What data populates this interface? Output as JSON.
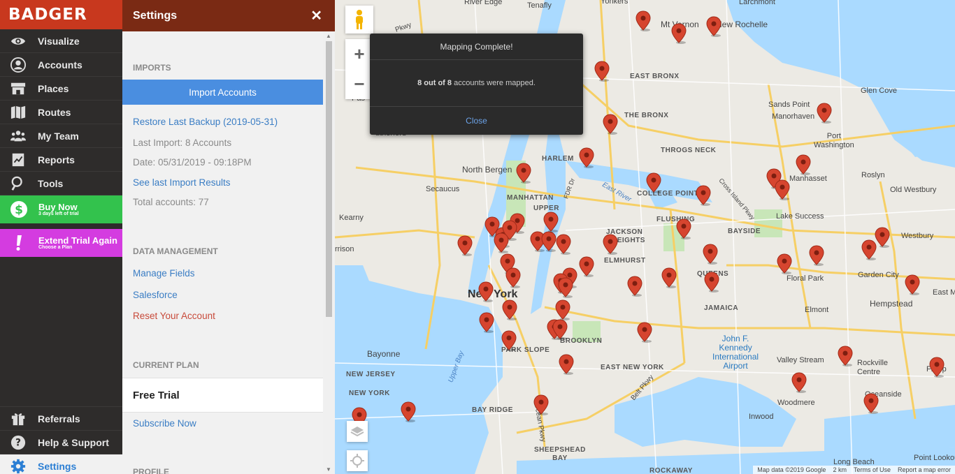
{
  "app": {
    "logo": "BADGER"
  },
  "nav": {
    "items": [
      {
        "label": "Visualize",
        "icon": "eye-icon"
      },
      {
        "label": "Accounts",
        "icon": "user-circle-icon"
      },
      {
        "label": "Places",
        "icon": "store-icon"
      },
      {
        "label": "Routes",
        "icon": "map-icon"
      },
      {
        "label": "My Team",
        "icon": "team-icon"
      },
      {
        "label": "Reports",
        "icon": "report-icon"
      },
      {
        "label": "Tools",
        "icon": "tools-icon"
      }
    ],
    "buy_now": {
      "title": "Buy Now",
      "subtitle": "3 days left of trial"
    },
    "extend": {
      "title": "Extend Trial Again",
      "subtitle": "Choose a Plan"
    },
    "bottom": [
      {
        "label": "Referrals",
        "icon": "gift-icon"
      },
      {
        "label": "Help & Support",
        "icon": "help-icon"
      },
      {
        "label": "Settings",
        "icon": "gear-icon"
      }
    ]
  },
  "panel": {
    "title": "Settings",
    "close": "✕",
    "imports": {
      "heading": "IMPORTS",
      "import_button": "Import Accounts",
      "restore": "Restore Last Backup (2019-05-31)",
      "last_import": "Last Import: 8 Accounts",
      "date": "Date: 05/31/2019 - 09:18PM",
      "see_results": "See last Import Results",
      "total": "Total accounts: 77"
    },
    "data_management": {
      "heading": "DATA MANAGEMENT",
      "manage_fields": "Manage Fields",
      "salesforce": "Salesforce",
      "reset": "Reset Your Account"
    },
    "current_plan": {
      "heading": "CURRENT PLAN",
      "plan": "Free Trial",
      "subscribe": "Subscribe Now"
    },
    "profile": {
      "heading": "PROFILE"
    }
  },
  "modal": {
    "title": "Mapping Complete!",
    "mapped": "8",
    "total": "8",
    "out_of": "out of",
    "suffix": "accounts were mapped.",
    "close": "Close"
  },
  "map": {
    "labels": {
      "river_edge": "River Edge",
      "tenafly": "Tenafly",
      "yonkers": "Yonkers",
      "mt_vernon": "Mt Vernon",
      "new_rochelle": "New Rochelle",
      "larchmont": "Larchmont",
      "east_bronx": "EAST BRONX",
      "the_bronx": "THE BRONX",
      "glen_cove": "Glen Cove",
      "sands_point": "Sands Point",
      "manorhaven": "Manorhaven",
      "port_washington": "Port\nWashington",
      "throgs_neck": "THROGS NECK",
      "harlem": "HARLEM",
      "north_bergen": "North Bergen",
      "secaucus": "Secaucus",
      "manhasset": "Manhasset",
      "roslyn": "Roslyn",
      "old_westbury": "Old Westbury",
      "college_point": "COLLEGE POINT",
      "manhattan": "MANHATTAN",
      "upper": "UPPER",
      "east_river": "East River",
      "flushing": "FLUSHING",
      "lake_success": "Lake Success",
      "kearny": "Kearny",
      "bayside": "BAYSIDE",
      "jackson": "JACKSON",
      "heights": "HEIGHTS",
      "westbury": "Westbury",
      "elmhurst": "ELMHURST",
      "queens": "QUEENS",
      "floral_park": "Floral Park",
      "garden_city": "Garden City",
      "new_york": "New York",
      "jamaica": "JAMAICA",
      "hempstead": "Hempstead",
      "east_m": "East M",
      "elmont": "Elmont",
      "brooklyn": "BROOKLYN",
      "park_slope": "PARK SLOPE",
      "jfk": "John F.\nKennedy\nInternational\nAirport",
      "bayonne": "Bayonne",
      "east_new_york": "EAST NEW YORK",
      "valley_stream": "Valley Stream",
      "rockville": "Rockville\nCentre",
      "freep": "Freep",
      "new_jersey": "NEW JERSEY",
      "upper_bay": "Upper Bay",
      "new_york_small": "NEW YORK",
      "bay_ridge": "BAY RIDGE",
      "woodmere": "Woodmere",
      "oceanside": "Oceanside",
      "inwood": "Inwood",
      "ocean_pkwy": "Ocean Pkwy",
      "belt_pkwy": "Belt Pkwy",
      "sheepshead": "SHEEPSHEAD\nBAY",
      "long_beach": "Long Beach",
      "point_lookout": "Point Lookou",
      "rockaway": "ROCKAWAY",
      "harrison": "rrison",
      "pas": "Pas",
      "rutherford": "utherford",
      "hwy_pkwy": "Pkwy",
      "fdr": "FDR Dr",
      "cross_island": "Cross Island Pkwy",
      "belt_pkwy2": "Belt Pkwy"
    },
    "attribution": {
      "data": "Map data ©2019 Google",
      "scale": "2 km",
      "terms": "Terms of Use",
      "report": "Report a map error"
    },
    "accent_pin": "#d6452f"
  }
}
